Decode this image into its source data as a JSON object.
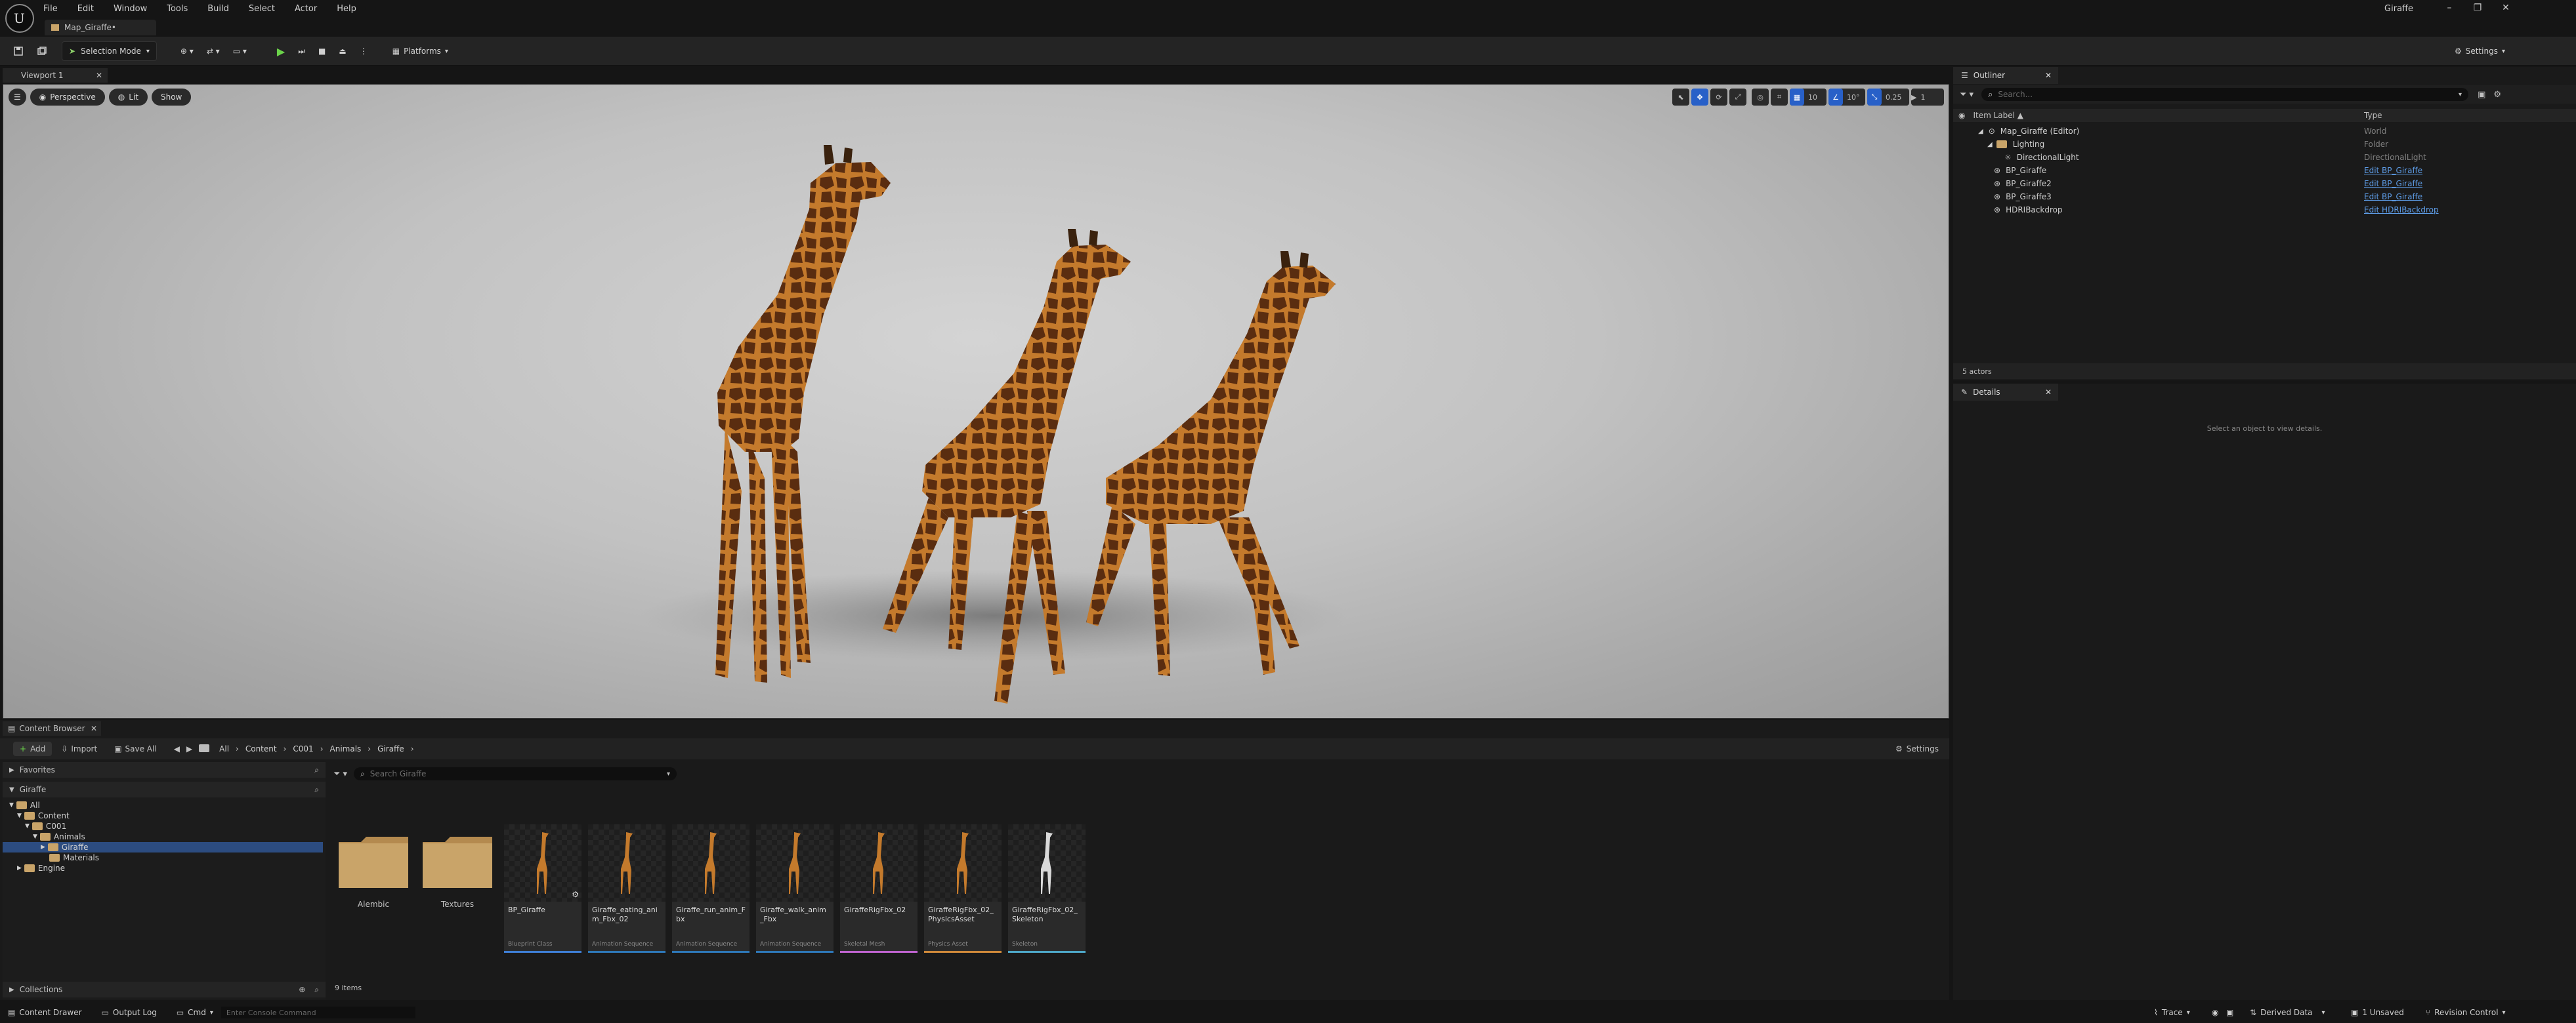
{
  "menu": [
    "File",
    "Edit",
    "Window",
    "Tools",
    "Build",
    "Select",
    "Actor",
    "Help"
  ],
  "window_title": "Giraffe",
  "document_tab": "Map_Giraffe•",
  "toolbar": {
    "selection_mode": "Selection Mode",
    "platforms": "Platforms",
    "settings": "Settings"
  },
  "viewport": {
    "tab": "Viewport 1",
    "perspective": "Perspective",
    "lit": "Lit",
    "show": "Show",
    "grid_size": "10",
    "rot_snap": "10°",
    "scale_snap": "0.25",
    "cam_speed": "1"
  },
  "outliner": {
    "title": "Outliner",
    "search_placeholder": "Search...",
    "col_label": "Item Label ▲",
    "col_type": "Type",
    "items": [
      {
        "label": "Map_Giraffe (Editor)",
        "type": "World",
        "link": false
      },
      {
        "label": "Lighting",
        "type": "Folder",
        "link": false
      },
      {
        "label": "DirectionalLight",
        "type": "DirectionalLight",
        "link": false
      },
      {
        "label": "BP_Giraffe",
        "type": "Edit BP_Giraffe",
        "link": true
      },
      {
        "label": "BP_Giraffe2",
        "type": "Edit BP_Giraffe",
        "link": true
      },
      {
        "label": "BP_Giraffe3",
        "type": "Edit BP_Giraffe",
        "link": true
      },
      {
        "label": "HDRIBackdrop",
        "type": "Edit HDRIBackdrop",
        "link": true
      }
    ],
    "count": "5 actors"
  },
  "details": {
    "title": "Details",
    "empty": "Select an object to view details."
  },
  "content_browser": {
    "title": "Content Browser",
    "add": "Add",
    "import": "Import",
    "save_all": "Save All",
    "settings": "Settings",
    "breadcrumbs": [
      "All",
      "Content",
      "C001",
      "Animals",
      "Giraffe"
    ],
    "favorites": "Favorites",
    "root_label": "Giraffe",
    "tree": [
      "All",
      "Content",
      "C001",
      "Animals",
      "Giraffe",
      "Materials",
      "Engine"
    ],
    "search_placeholder": "Search Giraffe",
    "folders": [
      "Alembic",
      "Textures"
    ],
    "assets": [
      {
        "name": "BP_Giraffe",
        "kind": "Blueprint Class",
        "color": "#3f7fd6"
      },
      {
        "name": "Giraffe_eating_anim_Fbx_02",
        "kind": "Animation Sequence",
        "color": "#2e78b8"
      },
      {
        "name": "Giraffe_run_anim_Fbx",
        "kind": "Animation Sequence",
        "color": "#2e78b8"
      },
      {
        "name": "Giraffe_walk_anim_Fbx",
        "kind": "Animation Sequence",
        "color": "#2e78b8"
      },
      {
        "name": "GiraffeRigFbx_02",
        "kind": "Skeletal Mesh",
        "color": "#c064d0"
      },
      {
        "name": "GiraffeRigFbx_02_PhysicsAsset",
        "kind": "Physics Asset",
        "color": "#d08a3a"
      },
      {
        "name": "GiraffeRigFbx_02_Skeleton",
        "kind": "Skeleton",
        "color": "#4ea8c8"
      }
    ],
    "item_count": "9 items",
    "collections": "Collections"
  },
  "status": {
    "content_drawer": "Content Drawer",
    "output_log": "Output Log",
    "cmd": "Cmd",
    "console_placeholder": "Enter Console Command",
    "trace": "Trace",
    "derived_data": "Derived Data",
    "unsaved": "1 Unsaved",
    "revision": "Revision Control"
  },
  "colors": {
    "accent": "#2860c8",
    "folder": "#c9a469",
    "link": "#5e9de8",
    "giraffe_body": "#c47a2c",
    "giraffe_spot": "#5a2d10"
  }
}
